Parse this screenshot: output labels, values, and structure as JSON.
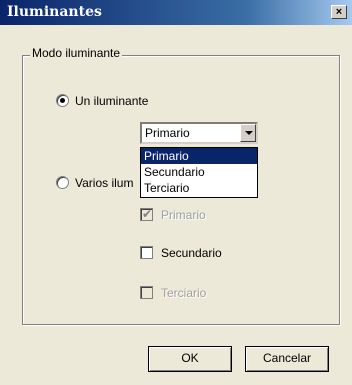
{
  "window": {
    "title": "Iluminantes",
    "close_glyph": "×"
  },
  "group": {
    "legend": "Modo iluminante"
  },
  "modes": {
    "single": {
      "label": "Un iluminante",
      "selected": true
    },
    "multiple": {
      "label": "Varios ilum",
      "selected": false
    }
  },
  "select": {
    "value": "Primario",
    "options": [
      "Primario",
      "Secundario",
      "Terciario"
    ],
    "highlighted_index": 0
  },
  "checkboxes": {
    "primario": {
      "label": "Primario",
      "checked": true,
      "enabled": false
    },
    "secundario": {
      "label": "Secundario",
      "checked": false,
      "enabled": true
    },
    "terciario": {
      "label": "Terciario",
      "checked": false,
      "enabled": false
    }
  },
  "buttons": {
    "ok": "OK",
    "cancel": "Cancelar"
  }
}
